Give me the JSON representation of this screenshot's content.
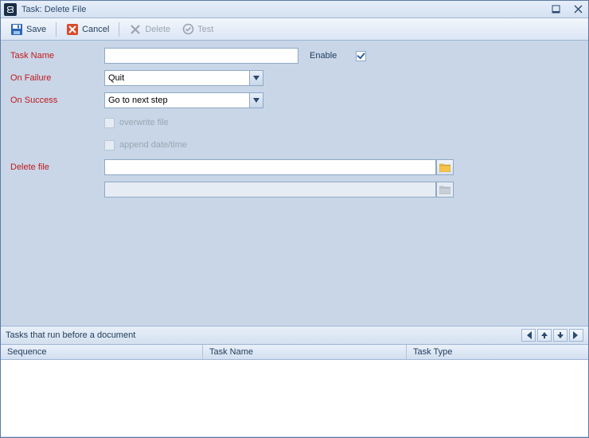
{
  "window": {
    "title": "Task: Delete File"
  },
  "toolbar": {
    "save": "Save",
    "cancel": "Cancel",
    "delete": "Delete",
    "test": "Test"
  },
  "form": {
    "task_name_label": "Task Name",
    "task_name_value": "",
    "enable_label": "Enable",
    "enable_checked": true,
    "on_failure_label": "On Failure",
    "on_failure_value": "Quit",
    "on_success_label": "On Success",
    "on_success_value": "Go to next step",
    "overwrite_label": "overwrite file",
    "append_label": "append date/time",
    "delete_file_label": "Delete file",
    "delete_file_value": "",
    "second_file_value": ""
  },
  "lower": {
    "title": "Tasks that run before a document",
    "columns": {
      "sequence": "Sequence",
      "task_name": "Task Name",
      "task_type": "Task Type"
    },
    "rows": []
  },
  "icons": {
    "app": "link-icon",
    "minimize": "minimize-icon",
    "close": "close-icon",
    "save": "save-icon",
    "cancel": "cancel-icon",
    "delete": "delete-icon",
    "test": "test-icon",
    "folder": "folder-icon",
    "folder_disabled": "folder-icon",
    "go_first": "go-first-icon",
    "go_up": "go-up-icon",
    "go_down": "go-down-icon",
    "go_last": "go-last-icon"
  }
}
